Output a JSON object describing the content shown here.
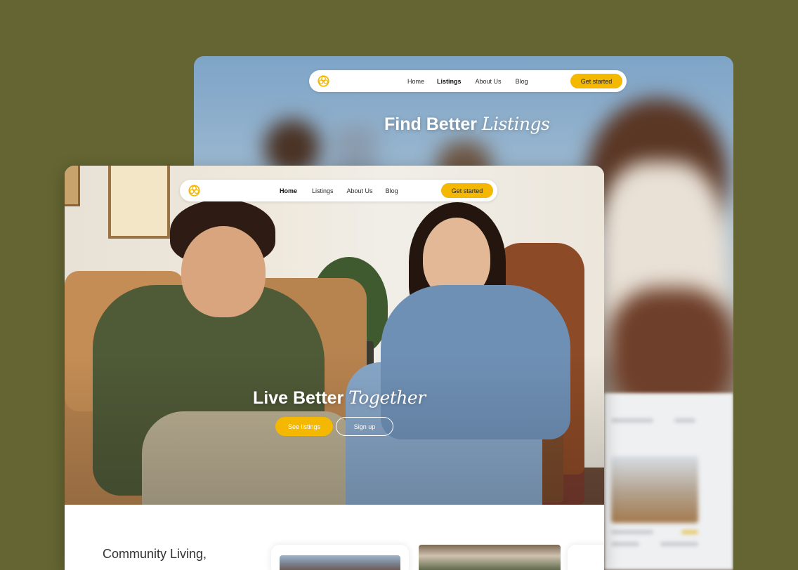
{
  "back_window": {
    "nav": {
      "links": [
        "Home",
        "Listings",
        "About Us",
        "Blog"
      ],
      "active": "Listings",
      "cta_label": "Get started"
    },
    "hero": {
      "title_plain": "Find Better",
      "title_italic": "Listings"
    }
  },
  "front_window": {
    "nav": {
      "links": [
        "Home",
        "Listings",
        "About Us",
        "Blog"
      ],
      "active": "Home",
      "cta_label": "Get started"
    },
    "hero": {
      "title_plain": "Live Better",
      "title_italic": "Together",
      "primary_button": "See listings",
      "secondary_button": "Sign up"
    },
    "section": {
      "heading": "Community Living,"
    }
  },
  "colors": {
    "background": "#646532",
    "accent": "#f5b800"
  },
  "icons": {
    "logo": "flower-logo-icon"
  }
}
